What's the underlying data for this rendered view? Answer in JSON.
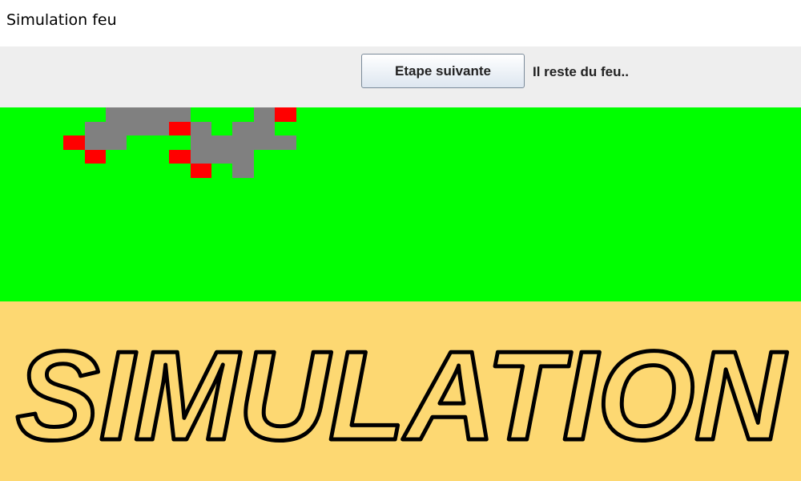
{
  "window": {
    "title": "Simulation feu"
  },
  "toolbar": {
    "next_step_label": "Etape suivante",
    "status_text": "Il reste du feu.."
  },
  "grid": {
    "cell_colors": {
      "tree": "#00ff00",
      "burnt": "#808080",
      "fire": "#ff0000"
    },
    "cells": [
      {
        "row": 0,
        "col": 5,
        "state": "burnt"
      },
      {
        "row": 0,
        "col": 6,
        "state": "burnt"
      },
      {
        "row": 0,
        "col": 7,
        "state": "burnt"
      },
      {
        "row": 0,
        "col": 8,
        "state": "burnt"
      },
      {
        "row": 0,
        "col": 12,
        "state": "burnt"
      },
      {
        "row": 0,
        "col": 13,
        "state": "fire"
      },
      {
        "row": 1,
        "col": 4,
        "state": "burnt"
      },
      {
        "row": 1,
        "col": 5,
        "state": "burnt"
      },
      {
        "row": 1,
        "col": 6,
        "state": "burnt"
      },
      {
        "row": 1,
        "col": 7,
        "state": "burnt"
      },
      {
        "row": 1,
        "col": 8,
        "state": "fire"
      },
      {
        "row": 1,
        "col": 9,
        "state": "burnt"
      },
      {
        "row": 1,
        "col": 11,
        "state": "burnt"
      },
      {
        "row": 1,
        "col": 12,
        "state": "burnt"
      },
      {
        "row": 2,
        "col": 3,
        "state": "fire"
      },
      {
        "row": 2,
        "col": 4,
        "state": "burnt"
      },
      {
        "row": 2,
        "col": 5,
        "state": "burnt"
      },
      {
        "row": 2,
        "col": 9,
        "state": "burnt"
      },
      {
        "row": 2,
        "col": 10,
        "state": "burnt"
      },
      {
        "row": 2,
        "col": 11,
        "state": "burnt"
      },
      {
        "row": 2,
        "col": 12,
        "state": "burnt"
      },
      {
        "row": 2,
        "col": 13,
        "state": "burnt"
      },
      {
        "row": 3,
        "col": 4,
        "state": "fire"
      },
      {
        "row": 3,
        "col": 8,
        "state": "fire"
      },
      {
        "row": 3,
        "col": 9,
        "state": "burnt"
      },
      {
        "row": 3,
        "col": 10,
        "state": "burnt"
      },
      {
        "row": 3,
        "col": 11,
        "state": "burnt"
      },
      {
        "row": 4,
        "col": 9,
        "state": "fire"
      },
      {
        "row": 4,
        "col": 11,
        "state": "burnt"
      }
    ]
  },
  "banner": {
    "text": "SIMULATION",
    "background": "#fdd872"
  }
}
